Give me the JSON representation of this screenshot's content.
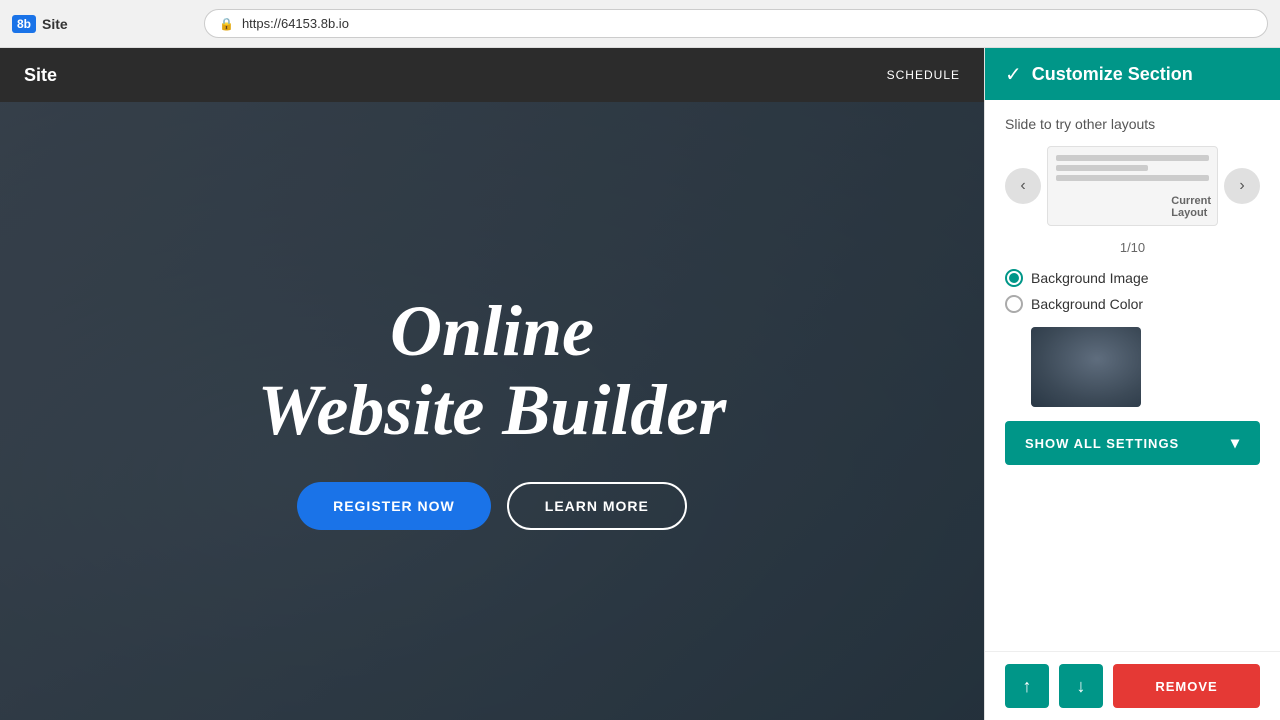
{
  "browser": {
    "logo_badge": "8b",
    "logo_text": "Site",
    "url": "https://64153.8b.io"
  },
  "site_nav": {
    "logo": "Site",
    "links": [
      "SCHEDULE"
    ]
  },
  "hero": {
    "title_line1": "Online",
    "title_line2": "Website Builder",
    "btn_primary": "REGISTER NOW",
    "btn_outline": "LEARN MORE"
  },
  "panel": {
    "header_title": "Customize Section",
    "slide_hint": "Slide to try other layouts",
    "layout_label": "Current\nLayout",
    "layout_counter": "1/10",
    "bg_image_label": "Background Image",
    "bg_color_label": "Background Color",
    "show_settings_label": "SHOW ALL SETTINGS",
    "move_up_label": "↑",
    "move_down_label": "↓",
    "remove_label": "REMOVE"
  }
}
